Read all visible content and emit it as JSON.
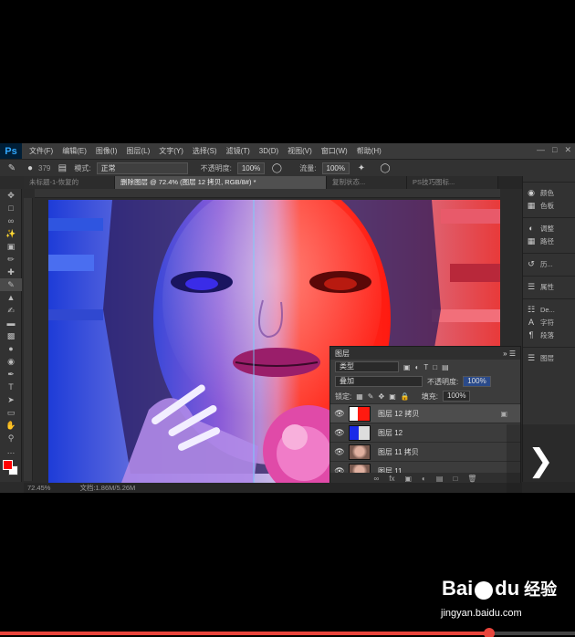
{
  "app": {
    "logo": "Ps"
  },
  "menu": [
    "文件(F)",
    "编辑(E)",
    "图像(I)",
    "图层(L)",
    "文字(Y)",
    "选择(S)",
    "滤镜(T)",
    "3D(D)",
    "视图(V)",
    "窗口(W)",
    "帮助(H)"
  ],
  "options": {
    "brush_size": "379",
    "mode_label": "模式:",
    "mode_value": "正常",
    "opacity_label": "不透明度:",
    "opacity_value": "100%",
    "flow_label": "流量:",
    "flow_value": "100%"
  },
  "tabs": [
    "未标题-1-恢复的",
    "删除图层 @ 72.4% (图层 12 拷贝, RGB/8#) *",
    "复制状态...",
    "PS技巧图标..."
  ],
  "dock": {
    "group1": [
      "颜色",
      "色板"
    ],
    "group2": [
      "调整",
      "路径"
    ],
    "group3": [
      "历..."
    ],
    "group4": [
      "属性"
    ],
    "group5": [
      "De...",
      "字符",
      "段落"
    ],
    "group6": [
      "图层"
    ]
  },
  "layers_panel": {
    "title": "图层",
    "kind_filter": "类型",
    "blend_mode": "叠加",
    "opacity_label": "不透明度:",
    "opacity_value": "100%",
    "lock_label": "锁定:",
    "fill_label": "填充:",
    "fill_value": "100%",
    "layers": [
      {
        "name": "图层 12 拷贝",
        "selected": true,
        "thumb": "red"
      },
      {
        "name": "图层 12",
        "selected": false,
        "thumb": "blue"
      },
      {
        "name": "图层 11 拷贝",
        "selected": false,
        "thumb": "photo"
      },
      {
        "name": "图层 11",
        "selected": false,
        "thumb": "photo"
      }
    ]
  },
  "status": {
    "zoom": "72.45%",
    "doc": "文档:1.86M/5.26M"
  },
  "watermark": {
    "brand": "Bai",
    "brand2": "du",
    "jingyan": "经验",
    "url": "jingyan.baidu.com"
  },
  "video_progress": 0.85,
  "colors": {
    "foreground": "#ff0000",
    "background": "#ffffff",
    "accent": "#e8453c"
  }
}
